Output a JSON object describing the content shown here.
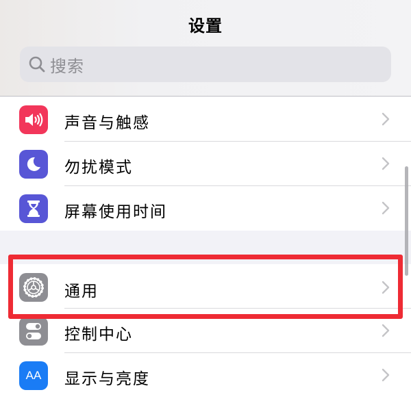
{
  "header": {
    "title": "设置"
  },
  "search": {
    "placeholder": "搜索"
  },
  "groups": [
    {
      "items": [
        {
          "label": "声音与触感",
          "icon": "speaker-icon",
          "color": "#f2365a"
        },
        {
          "label": "勿扰模式",
          "icon": "moon-icon",
          "color": "#5856d6"
        },
        {
          "label": "屏幕使用时间",
          "icon": "hourglass-icon",
          "color": "#5856d6"
        }
      ]
    },
    {
      "items": [
        {
          "label": "通用",
          "icon": "gear-icon",
          "color": "#8e8e93",
          "highlighted": true
        },
        {
          "label": "控制中心",
          "icon": "toggles-icon",
          "color": "#8e8e93"
        },
        {
          "label": "显示与亮度",
          "icon": "text-size-icon",
          "color": "#1a7cf5",
          "icon_text": "AA"
        }
      ]
    }
  ],
  "colors": {
    "highlight": "#ee2b34",
    "background": "#f2f2f7"
  }
}
